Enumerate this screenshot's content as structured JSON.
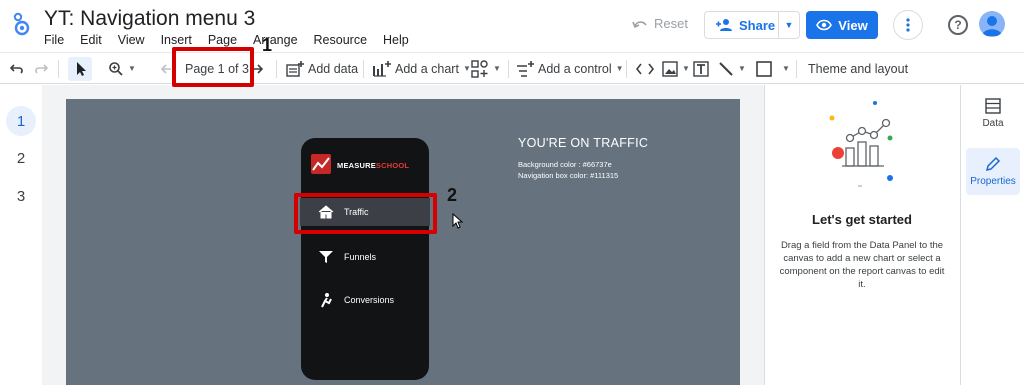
{
  "header": {
    "title": "YT: Navigation menu 3",
    "menu": [
      "File",
      "Edit",
      "View",
      "Insert",
      "Page",
      "Arrange",
      "Resource",
      "Help"
    ],
    "reset_label": "Reset",
    "share_label": "Share",
    "view_label": "View",
    "help_label": "?"
  },
  "toolbar": {
    "page_indicator": "Page 1 of 3",
    "add_data": "Add data",
    "add_chart": "Add a chart",
    "add_control": "Add a control",
    "theme_layout": "Theme and layout"
  },
  "pages": [
    "1",
    "2",
    "3"
  ],
  "report": {
    "logo_measure": "MEASURE",
    "logo_school": "SCHOOL",
    "nav_items": [
      "Traffic",
      "Funnels",
      "Conversions"
    ],
    "heading": "YOU'RE ON TRAFFIC",
    "bg_color_line": "Background color : #66737e",
    "nav_color_line": "Navigation box color: #111315",
    "background_color": "#66737e",
    "nav_box_color": "#111315"
  },
  "annotations": {
    "marker_1": "1",
    "marker_2": "2"
  },
  "right_panel": {
    "title": "Let's get started",
    "description": "Drag a field from the Data Panel to the canvas to add a new chart or select a component on the report canvas to edit it."
  },
  "side_tabs": {
    "data": "Data",
    "properties": "Properties"
  },
  "colors": {
    "accent": "#1a73e8",
    "highlight_red": "#d50000"
  }
}
